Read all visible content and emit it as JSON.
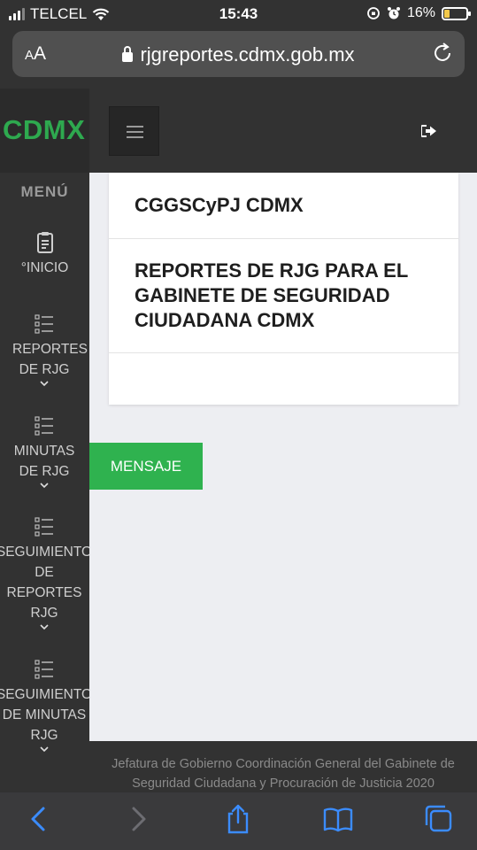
{
  "status_bar": {
    "carrier": "TELCEL",
    "time": "15:43",
    "battery": "16%"
  },
  "browser": {
    "text_size_label": "AA",
    "url": "rjgreportes.cdmx.gob.mx"
  },
  "site": {
    "logo": "CDMX"
  },
  "sidebar": {
    "title": "MENÚ",
    "items": [
      {
        "label": "°INICIO"
      },
      {
        "label": "REPORTES DE RJG"
      },
      {
        "label": "MINUTAS DE RJG"
      },
      {
        "label": "SEGUIMIENTO DE REPORTES RJG"
      },
      {
        "label": "SEGUIMIENTO DE MINUTAS RJG"
      }
    ]
  },
  "main": {
    "heading": "CGGSCyPJ CDMX",
    "subheading": "REPORTES DE RJG PARA EL GABINETE DE SEGURIDAD CIUDADANA CDMX",
    "message_button": "MENSAJE"
  },
  "footer": {
    "line1": "Jefatura de Gobierno Coordinación General del Gabinete de",
    "line2": "Seguridad Ciudadana y Procuración de Justicia 2020"
  },
  "colors": {
    "brand_green": "#2ea94f",
    "button_green": "#2fb24f",
    "dark_bg": "#323232",
    "content_bg": "#edeef2"
  }
}
